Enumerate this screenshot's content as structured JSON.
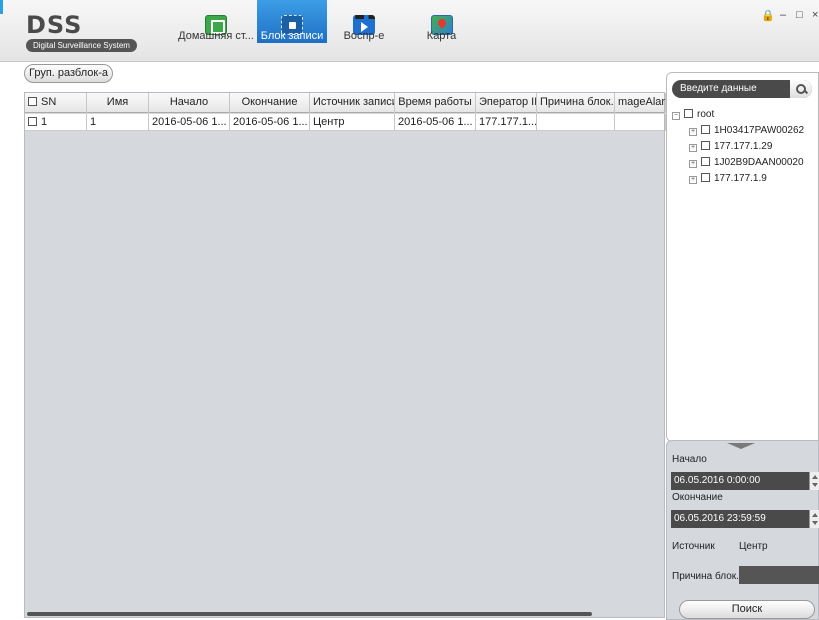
{
  "app": {
    "logo_title": "DSS",
    "logo_subtitle": "Digital Surveillance System"
  },
  "tabs": [
    {
      "label": "Домашняя ст...",
      "icon": "home-icon"
    },
    {
      "label": "Блок записи",
      "icon": "record-lock-icon",
      "active": true
    },
    {
      "label": "Воспр-е",
      "icon": "playback-icon"
    },
    {
      "label": "Карта",
      "icon": "map-icon"
    }
  ],
  "window": {
    "lock": "🔒",
    "minimize": "–",
    "maximize": "□",
    "close": "×"
  },
  "toolbar": {
    "group_unlock_label": "Груп. разблок-а"
  },
  "table": {
    "headers": [
      "SN",
      "Имя",
      "Начало",
      "Окончание",
      "Источник записи",
      "Время работы",
      "Эператор IP",
      "Причина блок.",
      "mageAlarm"
    ],
    "rows": [
      [
        "1",
        "1",
        "2016-05-06 1...",
        "2016-05-06 1...",
        "Центр",
        "2016-05-06 1...",
        "177.177.1...",
        "",
        ""
      ]
    ]
  },
  "search": {
    "placeholder": "Введите данные"
  },
  "tree": {
    "root": "root",
    "children": [
      "1H03417PAW00262",
      "177.177.1.29",
      "1J02B9DAAN00020",
      "177.177.1.9"
    ]
  },
  "filters": {
    "start_label": "Начало",
    "start_value": "06.05.2016 0:00:00",
    "end_label": "Окончание",
    "end_value": "06.05.2016 23:59:59",
    "source_label": "Источник",
    "source_value": "Центр",
    "reason_label": "Причина блок.",
    "search_button": "Поиск"
  },
  "colors": {
    "active_tab": "#1e6fc4",
    "panel_bg": "#d5d9de",
    "accent": "#2aa0e0"
  }
}
